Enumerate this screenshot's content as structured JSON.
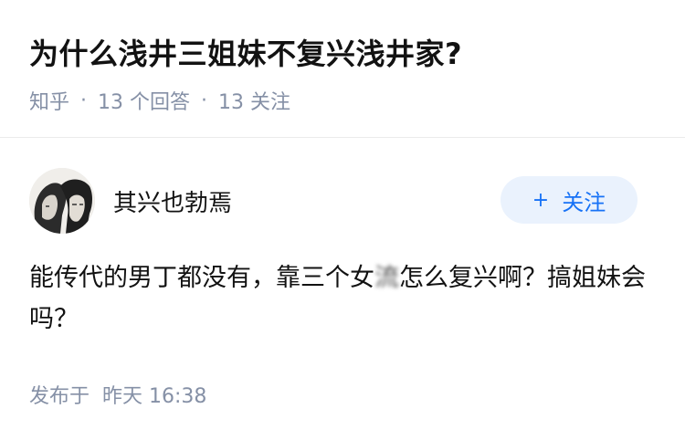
{
  "question": {
    "title": "为什么浅井三姐妹不复兴浅井家?",
    "source": "知乎",
    "answer_count": "13 个回答",
    "follower_count": "13 关注"
  },
  "author": {
    "name": "其兴也勃焉",
    "follow_label": "关注"
  },
  "answer": {
    "text_before": "能传代的男丁都没有，靠三个女",
    "text_blurred": "流",
    "text_after": "怎么复兴啊？搞姐妹会吗？"
  },
  "publish": {
    "label": "发布于",
    "time": "昨天 16:38"
  },
  "colors": {
    "meta_gray": "#8590a6",
    "follow_bg": "#eaf2fd",
    "follow_text": "#1772f6"
  },
  "icons": {
    "follow": "plus-icon"
  }
}
